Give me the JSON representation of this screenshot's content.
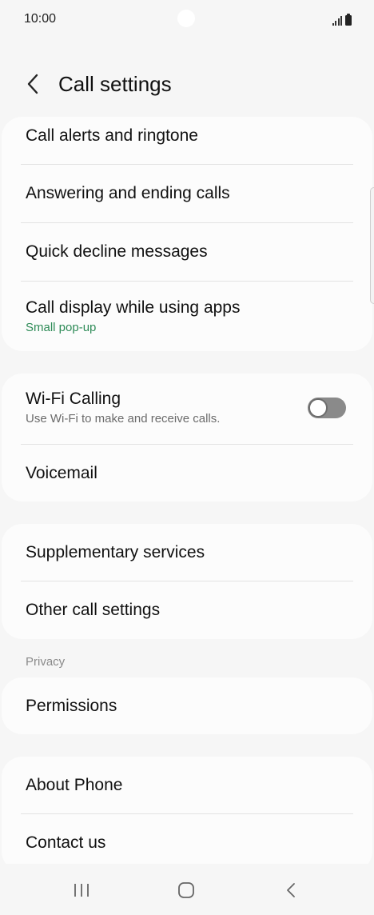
{
  "status_bar": {
    "time": "10:00",
    "signal_icon": "signal-bars-icon",
    "battery_icon": "battery-icon"
  },
  "header": {
    "back_icon": "chevron-left-icon",
    "title": "Call settings"
  },
  "groups": [
    {
      "items": [
        {
          "label": "Call alerts and ringtone"
        },
        {
          "label": "Answering and ending calls"
        },
        {
          "label": "Quick decline messages"
        },
        {
          "label": "Call display while using apps",
          "sub": "Small pop-up"
        }
      ]
    },
    {
      "items": [
        {
          "label": "Wi-Fi Calling",
          "sub": "Use Wi-Fi to make and receive calls.",
          "toggle": false
        },
        {
          "label": "Voicemail"
        }
      ]
    },
    {
      "items": [
        {
          "label": "Supplementary services"
        },
        {
          "label": "Other call settings"
        }
      ]
    }
  ],
  "privacy_section": {
    "label": "Privacy",
    "items": [
      {
        "label": "Permissions"
      }
    ]
  },
  "about_group": {
    "items": [
      {
        "label": "About Phone"
      },
      {
        "label": "Contact us"
      }
    ]
  },
  "colors": {
    "background": "#f6f6f6",
    "card": "#fcfcfc",
    "accent_green": "#2e8b57",
    "toggle_off": "#8a8a8a"
  },
  "nav_bar": {
    "recents_icon": "recents-icon",
    "home_icon": "home-icon",
    "back_icon": "back-chevron-icon"
  }
}
